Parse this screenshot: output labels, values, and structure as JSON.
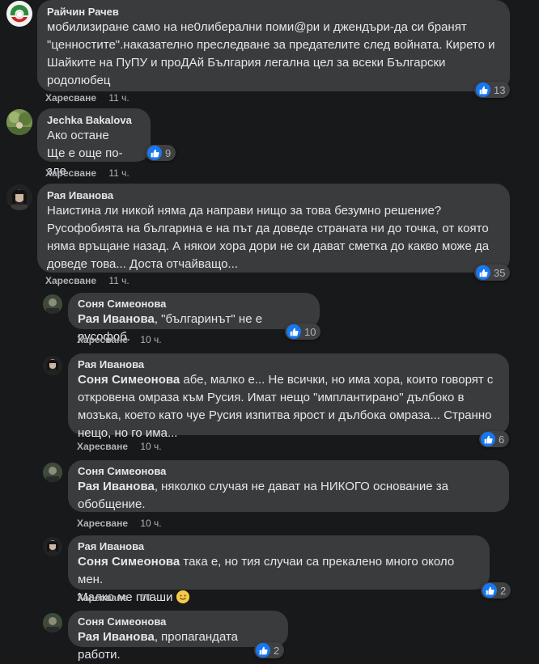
{
  "comments": [
    {
      "author": "Райчин Рачев",
      "lines": [
        "мобилизиране само на не0либерални поми@ри и джендъри-да си бранят",
        "\"ценностите\".наказателно преследване за предателите след войната. Кирето и",
        "Шайките на ПуПУ и проДАй България легална цел за всеки Български",
        "родолюбец"
      ],
      "like_label": "Харесване",
      "time": "11 ч.",
      "reactions": "13"
    },
    {
      "author": "Jechka Bakalova",
      "lines": [
        "Ако остане",
        "Ще е още по-зле"
      ],
      "like_label": "Харесване",
      "time": "11 ч.",
      "reactions": "9"
    },
    {
      "author": "Рая Иванова",
      "lines": [
        "Наистина ли никой няма да направи нищо за това безумно решение?",
        "Русофобията на българина е на път да доведе страната ни до точка, от която",
        "няма връщане назад. А някои хора дори не си дават сметка до какво може да",
        "доведе това... Доста отчайващо..."
      ],
      "like_label": "Харесване",
      "time": "11 ч.",
      "reactions": "35"
    }
  ],
  "replies": [
    {
      "author": "Соня Симеонова",
      "mention": "Рая Иванова",
      "lines": [
        ", \"българинът\" не е русофоб."
      ],
      "like_label": "Харесване",
      "time": "10 ч.",
      "reactions": "10"
    },
    {
      "author": "Рая Иванова",
      "mention": "Соня Симеонова",
      "lines": [
        " абе, малко е... Не всички, но има хора, които говорят с",
        "откровена омраза към Русия. Имат нещо \"имплантирано\" дълбоко в",
        "мозъка, което като чуе Русия изпитва ярост и дълбока омраза... Странно",
        "нещо, но го има..."
      ],
      "like_label": "Харесване",
      "time": "10 ч.",
      "reactions": "6"
    },
    {
      "author": "Соня Симеонова",
      "mention": "Рая Иванова",
      "lines": [
        ", няколко случая не дават на НИКОГО основание за",
        "обобщение."
      ],
      "like_label": "Харесване",
      "time": "10 ч."
    },
    {
      "author": "Рая Иванова",
      "mention": "Соня Симеонова",
      "lines": [
        " така е, но тия случаи са прекалено много около мен.",
        "Малко ме плаши"
      ],
      "emoji": "slightly-smiling-face-emoji",
      "like_label": "Харесване",
      "time": "10 ч.",
      "reactions": "2"
    },
    {
      "author": "Соня Симеонова",
      "mention": "Рая Иванова",
      "lines": [
        ", пропагандата работи."
      ],
      "reactions": "2"
    }
  ],
  "colors": {
    "background": "#18191a",
    "bubble": "#3a3b3c",
    "text": "#e4e6eb",
    "meta": "#b0b3b8",
    "like_blue": "#1877f2"
  }
}
